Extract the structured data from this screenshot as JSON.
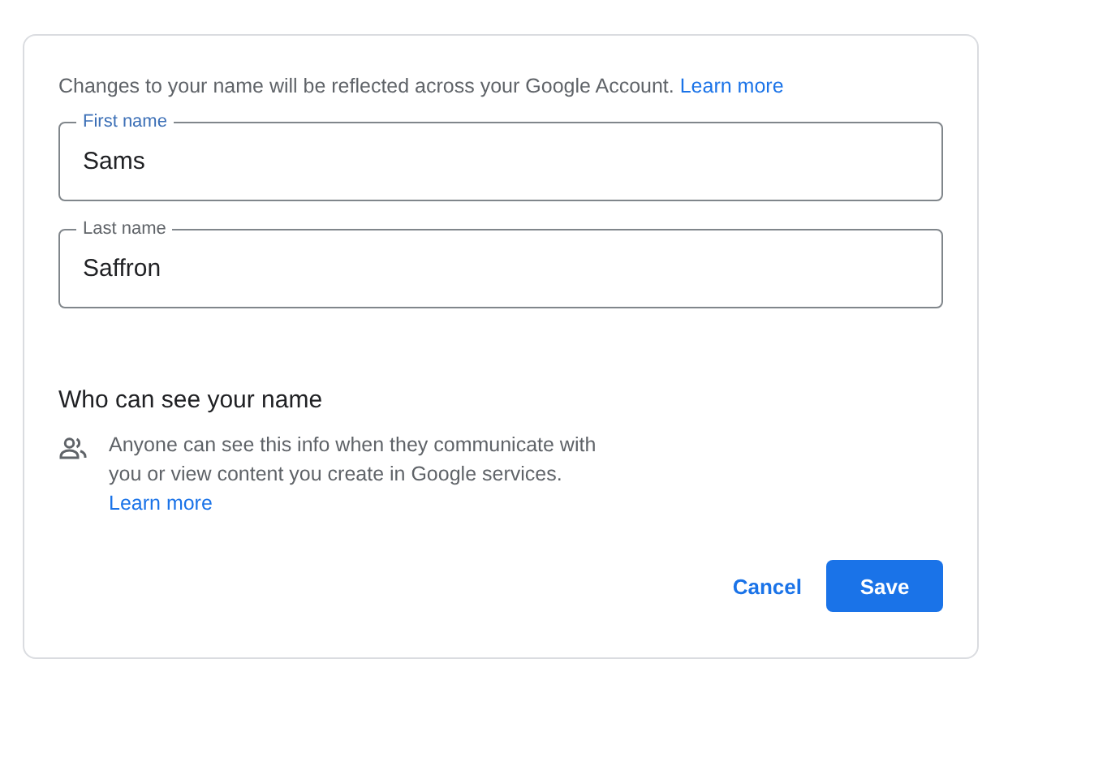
{
  "intro": {
    "text": "Changes to your name will be reflected across your Google Account.",
    "link": "Learn more"
  },
  "fields": [
    {
      "label": "First name",
      "value": "Sams",
      "focused": true
    },
    {
      "label": "Last name",
      "value": "Saffron",
      "focused": false
    }
  ],
  "visibility": {
    "heading": "Who can see your name",
    "text": "Anyone can see this info when they communicate with you or view content you create in Google services.",
    "link": "Learn more"
  },
  "buttons": {
    "cancel": "Cancel",
    "save": "Save"
  }
}
